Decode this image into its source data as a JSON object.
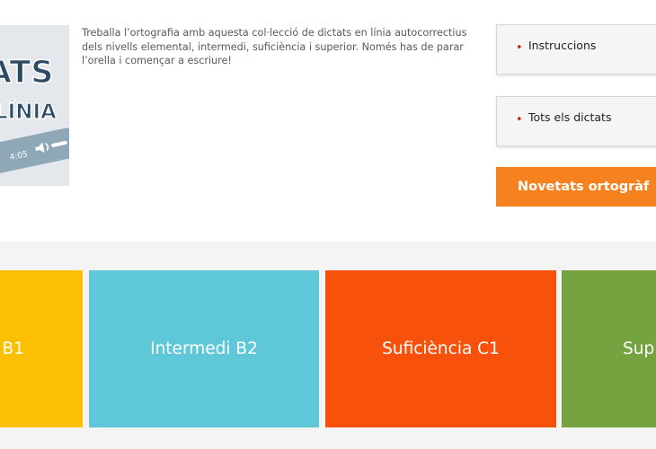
{
  "logo": {
    "text_top": "ATS",
    "text_bottom": "LÍNIA",
    "time_label": "4:05",
    "colors": {
      "background": "#e4e8ec",
      "text": "#2a4b63",
      "outline": "#ffffff"
    }
  },
  "intro": {
    "text": "Treballa l’ortografia amb aquesta col·lecció de dictats en línia autocorrectius dels nivells elemental, intermedi, suficiència i superior. Només has de parar l’orella i començar a escriure!"
  },
  "sidebar": {
    "bullet_glyph": "•",
    "buttons": [
      {
        "label": "Instruccions"
      },
      {
        "label": "Tots els dictats"
      }
    ],
    "cta": {
      "label": "Novetats ortogràf",
      "color": "#f5821f"
    }
  },
  "levels": [
    {
      "label": "B1",
      "color": "#fbc002"
    },
    {
      "label": "Intermedi B2",
      "color": "#5fc8d8"
    },
    {
      "label": "Suficiència C1",
      "color": "#f7510c"
    },
    {
      "label": "Sup",
      "color": "#74a33f"
    }
  ]
}
